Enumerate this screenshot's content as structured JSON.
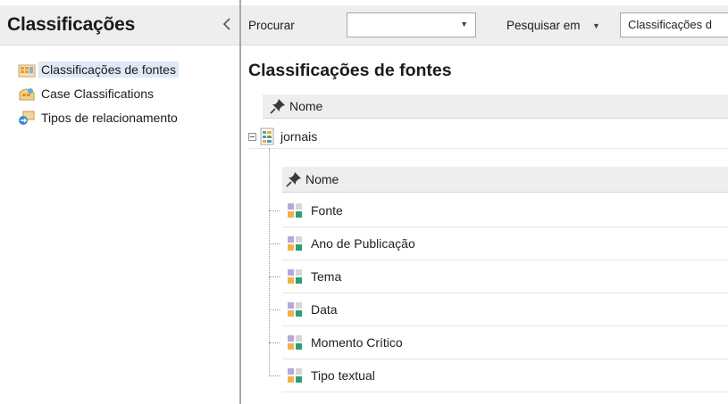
{
  "sidebar": {
    "title": "Classificações",
    "items": [
      {
        "label": "Classificações de fontes",
        "icon": "source-classification-icon",
        "selected": true
      },
      {
        "label": "Case Classifications",
        "icon": "case-classification-icon",
        "selected": false
      },
      {
        "label": "Tipos de relacionamento",
        "icon": "relationship-type-icon",
        "selected": false
      }
    ]
  },
  "toolbar": {
    "search_label": "Procurar",
    "search_value": "",
    "search_in_label": "Pesquisar em",
    "scope_value": "Classificações d"
  },
  "main": {
    "title": "Classificações de fontes",
    "column_header": "Nome",
    "classification": {
      "name": "jornais",
      "column_header": "Nome",
      "attributes": [
        "Fonte",
        "Ano de Publicação",
        "Tema",
        "Data",
        "Momento Crítico",
        "Tipo textual"
      ]
    }
  },
  "colors": {
    "accent": "#2b6cb0",
    "selection": "#dfe9f6",
    "header_bg": "#eeeeee"
  }
}
